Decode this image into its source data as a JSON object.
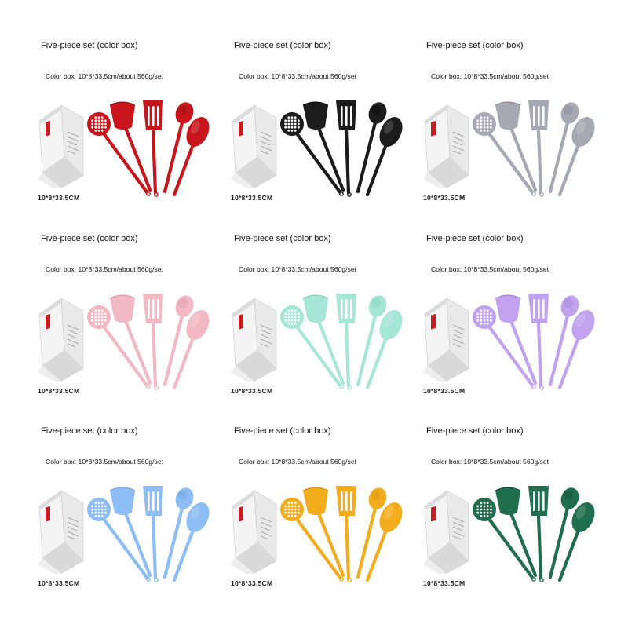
{
  "cells": [
    {
      "title": "Five-piece set (color box)",
      "spec": "Color box: 10*8*33.5cm/about 560g/set",
      "dims": "10*8*33.5CM",
      "color": "#c8151b",
      "shade": "#8e0d12"
    },
    {
      "title": "Five-piece set (color box)",
      "spec": "Color box: 10*8*33.5cm/about 560g/set",
      "dims": "10*8*33.5CM",
      "color": "#1c1c1c",
      "shade": "#000000"
    },
    {
      "title": "Five-piece set (color box)",
      "spec": "Color box: 10*8*33.5cm/about 560g/set",
      "dims": "10*8*33.5CM",
      "color": "#a6a8b3",
      "shade": "#7e808b"
    },
    {
      "title": "Five-piece set (color box)",
      "spec": "Color box: 10*8*33.5cm/about 560g/set",
      "dims": "10*8*33.5CM",
      "color": "#f2b8c3",
      "shade": "#d896a3"
    },
    {
      "title": "Five-piece set (color box)",
      "spec": "Color box: 10*8*33.5cm/about 560g/set",
      "dims": "10*8*33.5CM",
      "color": "#a6e6d6",
      "shade": "#7fcdb9"
    },
    {
      "title": "Five-piece set (color box)",
      "spec": "Color box: 10*8*33.5cm/about 560g/set",
      "dims": "10*8*33.5CM",
      "color": "#c1a2ee",
      "shade": "#9e7fd6"
    },
    {
      "title": "Five-piece set (color box)",
      "spec": "Color box: 10*8*33.5cm/about 560g/set",
      "dims": "10*8*33.5CM",
      "color": "#8cbdf4",
      "shade": "#6a9fdc"
    },
    {
      "title": "Five-piece set (color box)",
      "spec": "Color box: 10*8*33.5cm/about 560g/set",
      "dims": "10*8*33.5CM",
      "color": "#f3ad1c",
      "shade": "#d38e08"
    },
    {
      "title": "Five-piece set (color box)",
      "spec": "Color box: 10*8*33.5cm/about 560g/set",
      "dims": "10*8*33.5CM",
      "color": "#1f6e4d",
      "shade": "#124a33"
    }
  ]
}
